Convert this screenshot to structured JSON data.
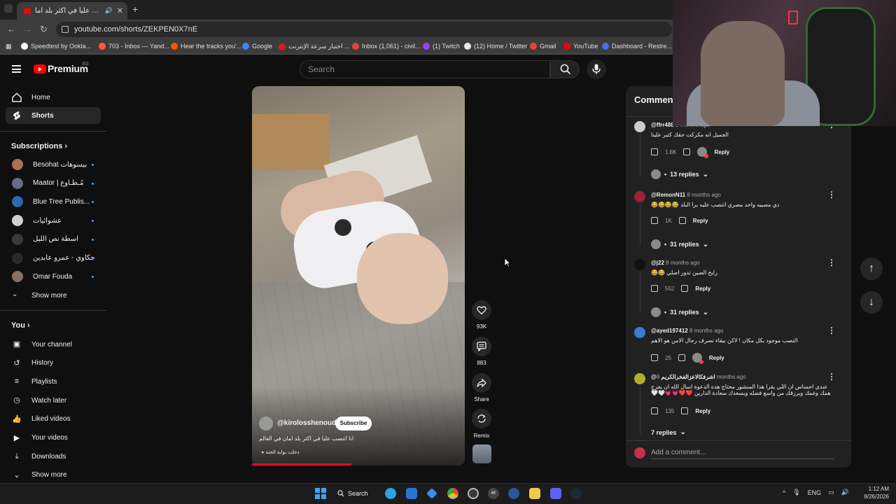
{
  "browser": {
    "tab_title": "انا اتنصب عليا في اكثر بلد اما...",
    "new_tab_icon": "plus-icon",
    "url": "youtube.com/shorts/ZEKPEN0X7nE",
    "bookmarks": [
      {
        "label": "Speedtest by Ookla...",
        "color": "#ffffff"
      },
      {
        "label": "703 - Inbox — Yand...",
        "color": "#ff5b3a"
      },
      {
        "label": "Hear the tracks you'...",
        "color": "#ff5500"
      },
      {
        "label": "Google",
        "color": "#4285f4"
      },
      {
        "label": "اختبار سرعة الإنترنت ...",
        "color": "#d61b2a"
      },
      {
        "label": "Inbox (1,061) - civil...",
        "color": "#ea4335"
      },
      {
        "label": "(1) Twitch",
        "color": "#9146ff"
      },
      {
        "label": "(12) Home / Twitter",
        "color": "#e7e9ea"
      },
      {
        "label": "Gmail",
        "color": "#ea4335"
      },
      {
        "label": "YouTube",
        "color": "#ff0000"
      },
      {
        "label": "Dashboard - Restre...",
        "color": "#4a6cf7"
      }
    ]
  },
  "masthead": {
    "logo": "Premium",
    "country": "EG",
    "search_placeholder": "Search"
  },
  "sidebar": {
    "home": "Home",
    "shorts": "Shorts",
    "subscriptions_title": "Subscriptions",
    "subscriptions": [
      {
        "name": "Besohat بيسوهات",
        "color": "#b07050"
      },
      {
        "name": "Maator | مُـطـاوع",
        "color": "#6a6a8a"
      },
      {
        "name": "Blue Tree Publis...",
        "color": "#2a6ab0"
      },
      {
        "name": "عشوائيات",
        "color": "#d0d0d0"
      },
      {
        "name": "اسطة نص الليل",
        "color": "#3a3a3a"
      },
      {
        "name": "حكاوي - عمرو عابدين",
        "color": "#2a2a2a"
      },
      {
        "name": "Omar Fouda",
        "color": "#8a7060"
      }
    ],
    "show_more": "Show more",
    "you_title": "You",
    "you_items": [
      "Your channel",
      "History",
      "Playlists",
      "Watch later",
      "Liked videos",
      "Your videos",
      "Downloads",
      "Show more"
    ]
  },
  "short": {
    "channel": "@kirolosshenouda",
    "subscribe": "Subscribe",
    "title": "انا اتنصب عليا في اكثر بلد امان في العالم",
    "sound": "دخلت بوابة الجنة",
    "likes": "93K",
    "comments": "883",
    "share": "Share",
    "remix": "Remix"
  },
  "comments": {
    "title": "Comments",
    "items": [
      {
        "user": "@ffrr488",
        "time": "8 months ago",
        "text": "الجميل انه مكركت حقك كتير علينا",
        "likes": "1.8K",
        "reply": "Reply",
        "replies": "13 replies",
        "avatar": "#cccccc"
      },
      {
        "user": "@RemonN11",
        "time": "8 months ago",
        "text": "دي مصيبه واحد مصري اتنصب عليه برا البلد 😂😂😂😂",
        "likes": "1K",
        "reply": "Reply",
        "replies": "31 replies",
        "avatar": "#a0203a"
      },
      {
        "user": "@j22",
        "time": "8 months ago",
        "text": "رايح الصين تدور اصلي 😂😂",
        "likes": "552",
        "reply": "Reply",
        "replies": "31 replies",
        "avatar": "#111111"
      },
      {
        "user": "@ayed197412",
        "time": "8 months ago",
        "text": "النصب موجود بكل مكان ! لاكن بيقاء تصرف رجال الامن هو الاهم",
        "likes": "25",
        "reply": "Reply",
        "replies": "",
        "avatar": "#3a7bd5"
      },
      {
        "user": "@اشرفكالاعزالفخرالكريم",
        "time": "8 months ago",
        "text": "عندي احساس ان اللي يقرا هذا المنشور محتاج هذه الدعوة اسال الله ان يفرج همك وغمك ويرزقك من واسع فضله ويسعدك سعادة الدارين ❤️❤️💗💗🤍🤍",
        "likes": "135",
        "reply": "Reply",
        "replies": "7 replies",
        "avatar": "#b0b030"
      }
    ],
    "add_placeholder": "Add a comment..."
  },
  "taskbar": {
    "search": "Search",
    "lang": "ENG",
    "time": "1:12 AM",
    "date": "8/26/2026"
  }
}
